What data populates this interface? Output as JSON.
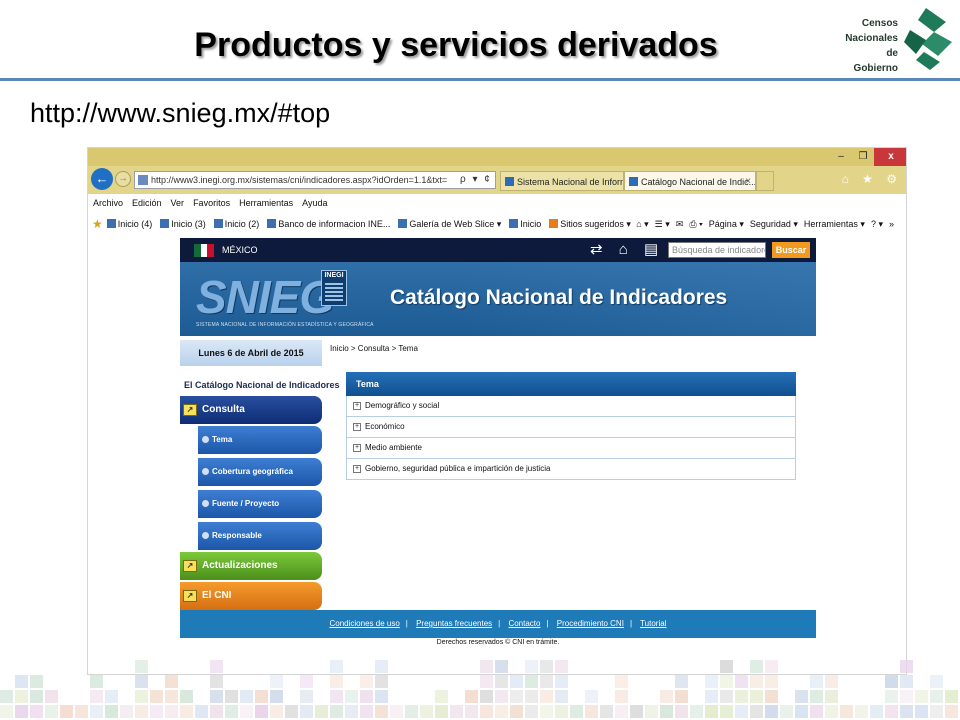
{
  "slide": {
    "title": "Productos y servicios derivados",
    "url": "http://www.snieg.mx/#top",
    "logo_lines": [
      "Censos",
      "Nacionales",
      "de Gobierno"
    ]
  },
  "browser": {
    "window_controls": [
      "–",
      "❐",
      "x"
    ],
    "address": "http://www3.inegi.org.mx/sistemas/cni/indicadores.aspx?idOrden=1.1&txt=",
    "address_tools": "ρ ▾ ¢",
    "tabs": [
      {
        "label": "Sistema Nacional de Informaci..."
      },
      {
        "label": "Catálogo Nacional de Indic...",
        "close": "×"
      }
    ],
    "nav_icons": "⌂ ★ ⚙",
    "menu": [
      "Archivo",
      "Edición",
      "Ver",
      "Favoritos",
      "Herramientas",
      "Ayuda"
    ],
    "favorites": [
      "Inicio (4)",
      "Inicio (3)",
      "Inicio (2)",
      "Banco de informacion INE...",
      "Galería de Web Slice ▾",
      "Inicio",
      "Sitios sugeridos ▾"
    ],
    "command_bar": [
      "⌂ ▾",
      "☰ ▾",
      "✉",
      "⎙ ▾",
      "Página ▾",
      "Seguridad ▾",
      "Herramientas ▾",
      "? ▾"
    ],
    "overflow": "»"
  },
  "site": {
    "country": "MÉXICO",
    "top_icons": "⇄ ⌂ ▤",
    "search_placeholder": "Búsqueda de indicadores",
    "search_button": "Buscar",
    "logo": "SNIEG",
    "logo_badge": "INEGI",
    "logo_subtitle": "SISTEMA NACIONAL DE INFORMACIÓN ESTADÍSTICA Y GEOGRÁFICA",
    "banner_title": "Catálogo Nacional de Indicadores",
    "date": "Lunes 6 de Abril de 2015",
    "sidebar_heading": "El Catálogo Nacional de Indicadores",
    "sidebar_sections": {
      "consulta": "Consulta",
      "actualizaciones": "Actualizaciones",
      "cni": "El CNI"
    },
    "sidebar_items": [
      "Tema",
      "Cobertura geográfica",
      "Fuente / Proyecto",
      "Responsable"
    ],
    "breadcrumb": "Inicio > Consulta > Tema",
    "panel_title": "Tema",
    "topics": [
      "Demográfico y social",
      "Económico",
      "Medio ambiente",
      "Gobierno, seguridad pública e impartición de justicia"
    ],
    "footer_links": [
      "Condiciones de uso",
      "Preguntas frecuentes",
      "Contacto",
      "Procedimiento CNI",
      "Tutorial"
    ],
    "footer_separator": "|",
    "copyright": "Derechos reservados © CNI en trámite."
  },
  "colors": {
    "title_rule": "#5b86b8",
    "browser_chrome": "#e2d589",
    "site_dark": "#0d1a3b",
    "banner_blue": "#2f6ea7",
    "search_button": "#f29a1f",
    "section_green": "#7bc93a",
    "section_orange": "#f59a2c",
    "footer_blue": "#1f7ab8"
  }
}
